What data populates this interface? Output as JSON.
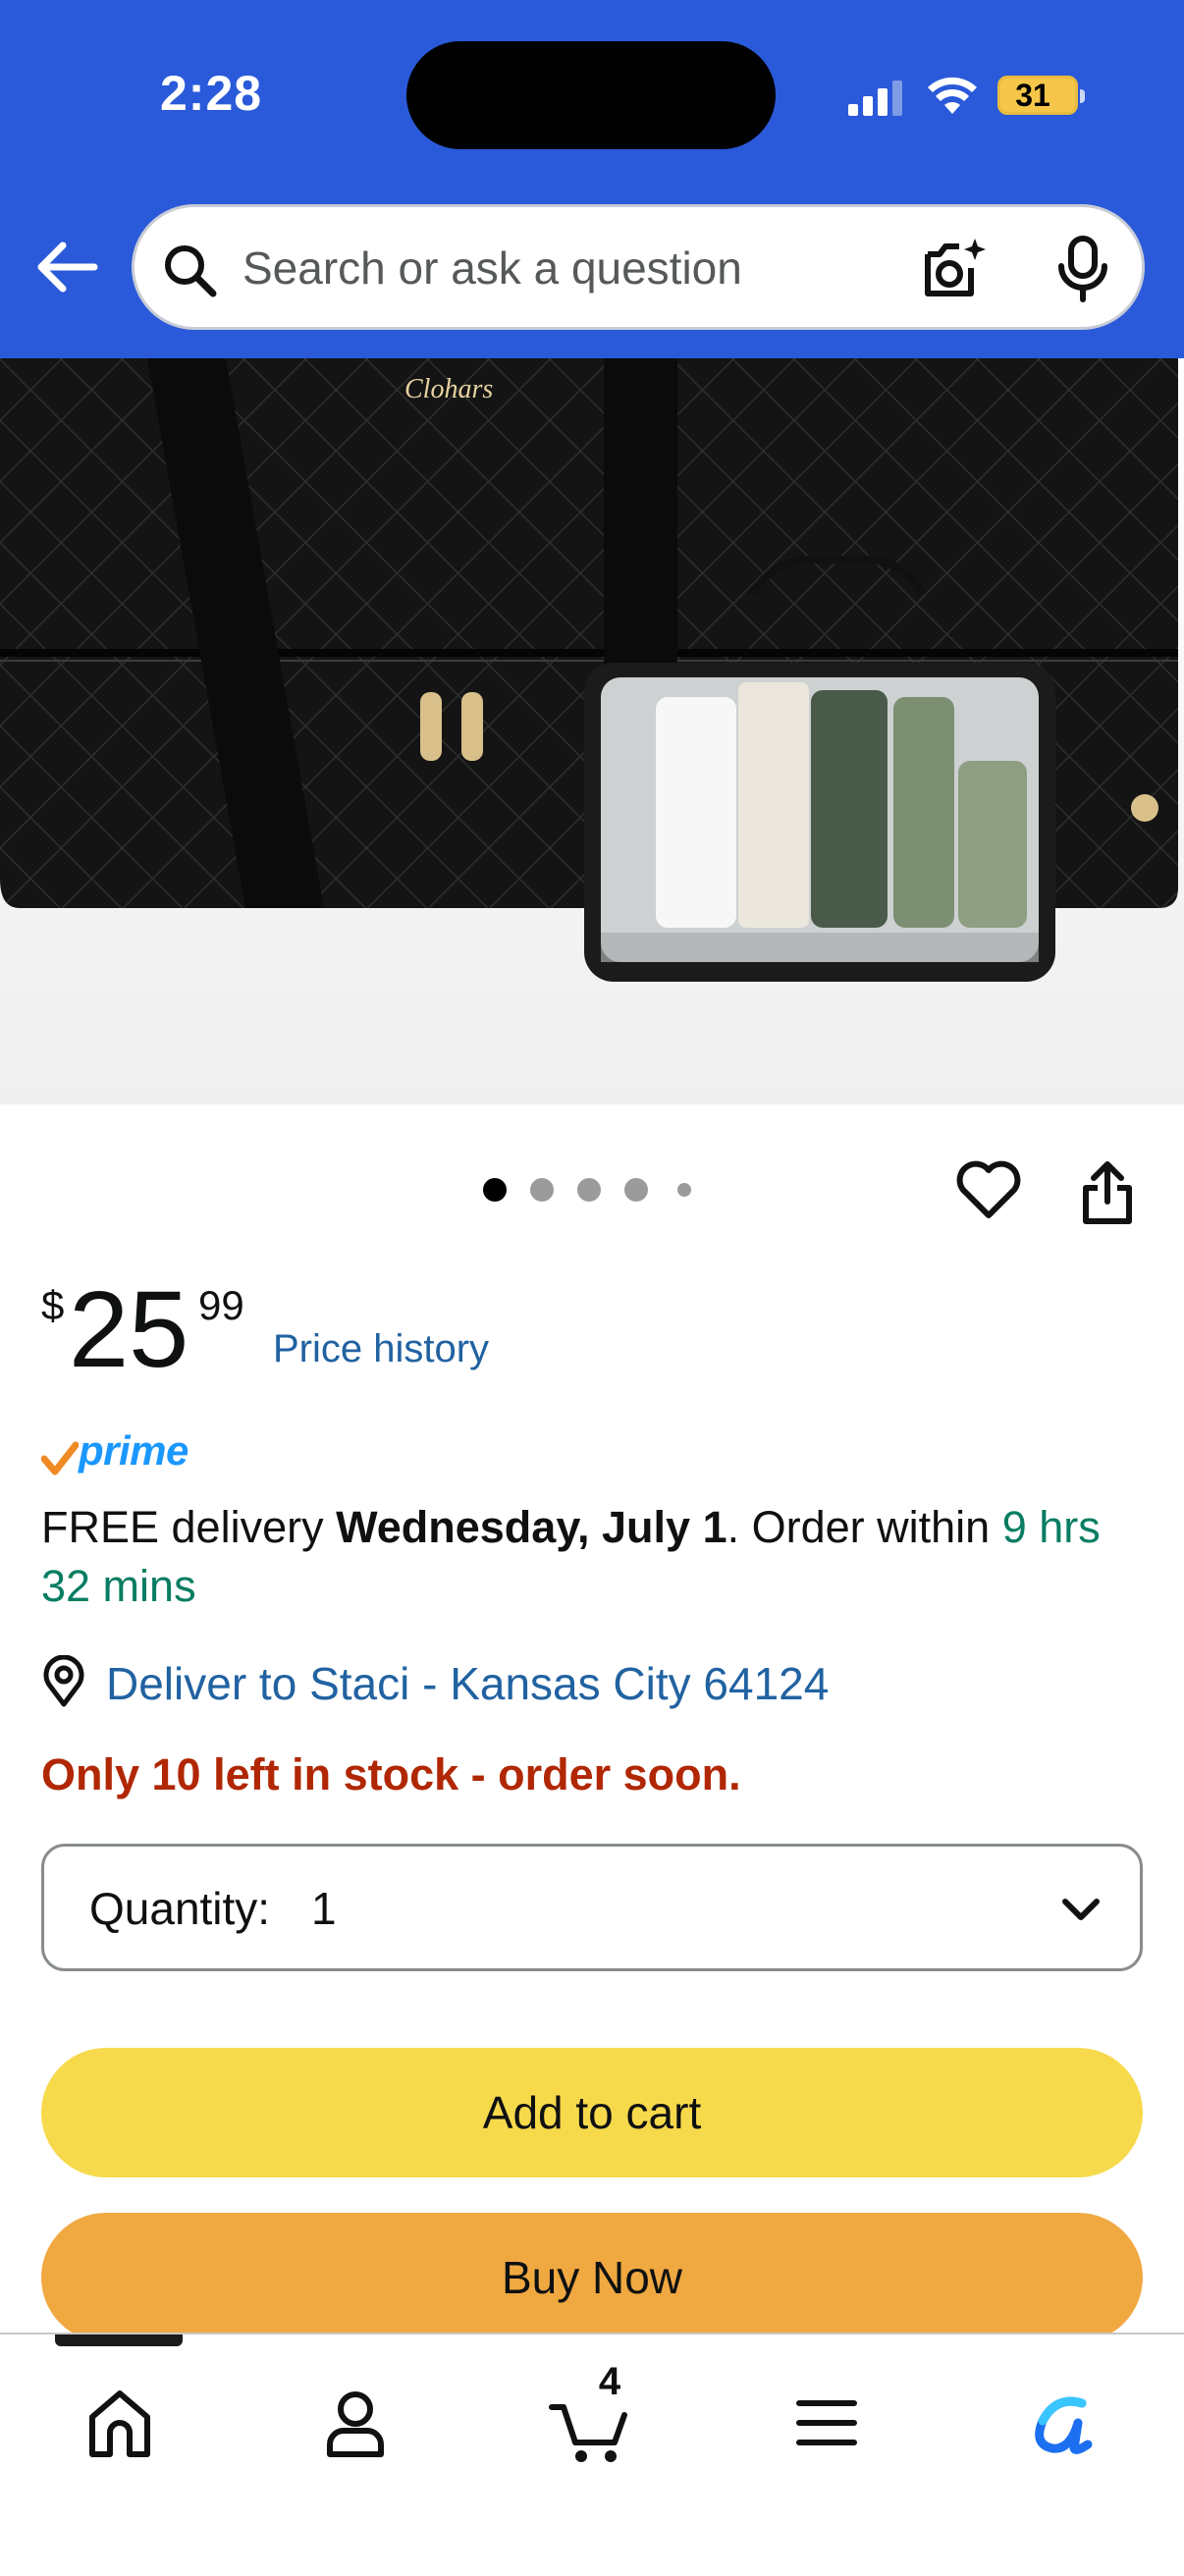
{
  "status_bar": {
    "time": "2:28",
    "battery": "31"
  },
  "search": {
    "placeholder": "Search or ask a question"
  },
  "product": {
    "image_brand": "Clohars",
    "image_count": 5,
    "active_image": 1
  },
  "price": {
    "symbol": "$",
    "whole": "25",
    "fraction": "99",
    "history_link": "Price history"
  },
  "prime": {
    "label": "prime"
  },
  "delivery": {
    "prefix": "FREE delivery ",
    "date": "Wednesday, July 1",
    "middle": ". Order within ",
    "countdown": "9 hrs 32 mins"
  },
  "deliver_to": "Deliver to Staci - Kansas City 64124",
  "stock_message": "Only 10 left in stock - order soon.",
  "quantity": {
    "label": "Quantity:",
    "value": "1"
  },
  "buttons": {
    "add_to_cart": "Add to cart",
    "buy_now": "Buy Now"
  },
  "tabbar": {
    "cart_count": "4",
    "active_tab": "home"
  },
  "colors": {
    "header": "#2a5ad9",
    "add_to_cart": "#f7d94c",
    "buy_now": "#f0a841",
    "link": "#2162a1",
    "stock": "#b12704",
    "prime": "#1a98ff"
  },
  "icons": [
    "back-arrow-icon",
    "search-icon",
    "camera-icon",
    "mic-icon",
    "heart-icon",
    "share-icon",
    "location-pin-icon",
    "chevron-down-icon",
    "home-icon",
    "account-icon",
    "cart-icon",
    "menu-icon",
    "rufus-icon"
  ]
}
